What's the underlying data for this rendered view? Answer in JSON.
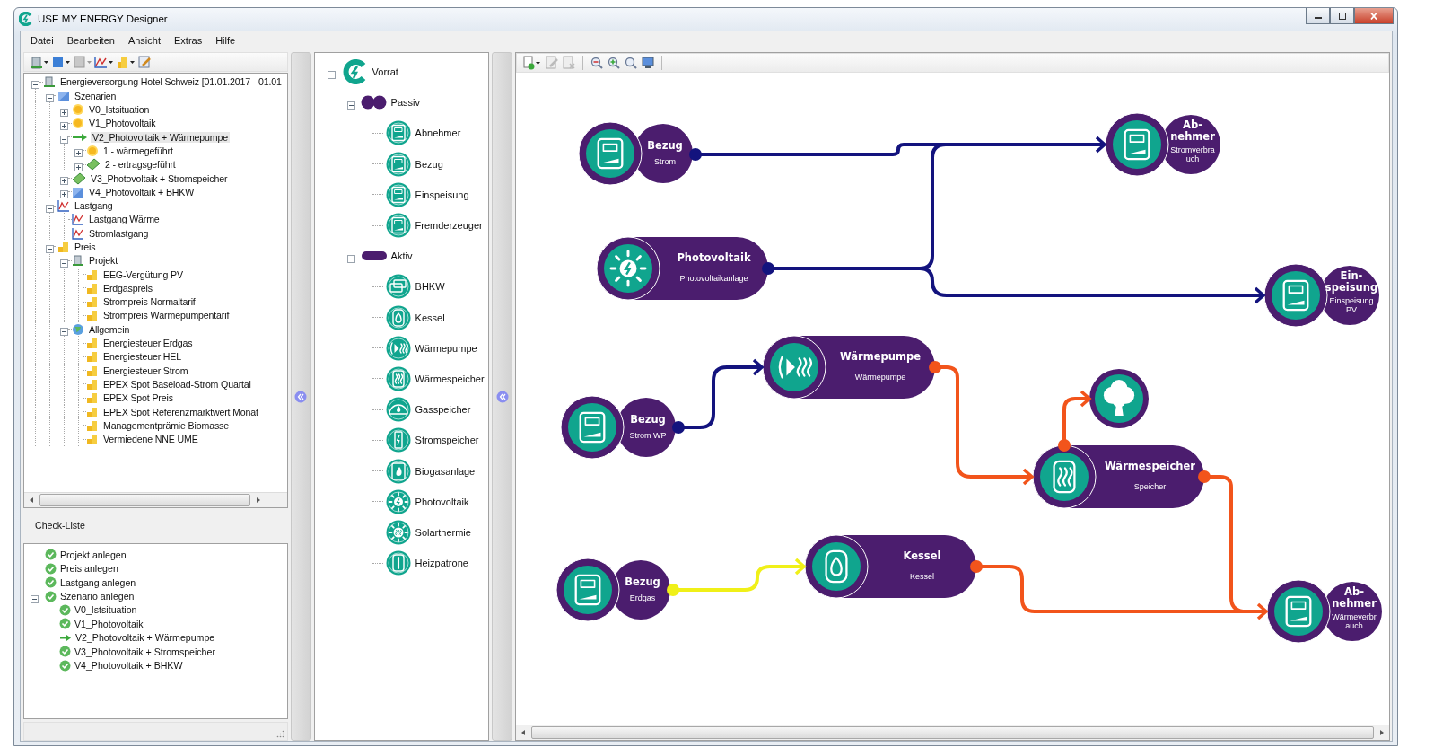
{
  "window": {
    "title": "USE MY ENERGY Designer"
  },
  "menu": [
    "Datei",
    "Bearbeiten",
    "Ansicht",
    "Extras",
    "Hilfe"
  ],
  "project_tree": [
    {
      "label": "Energieversorgung Hotel Schweiz [01.01.2017 - 01.01",
      "kind": "project",
      "expanded": true,
      "selected": false,
      "children": [
        {
          "label": "Szenarien",
          "kind": "square",
          "expanded": true,
          "selected": false,
          "children": [
            {
              "label": "V0_Istsituation",
              "kind": "sun",
              "expanded": false,
              "selected": false
            },
            {
              "label": "V1_Photovoltaik",
              "kind": "sun",
              "expanded": false,
              "selected": false
            },
            {
              "label": "V2_Photovoltaik + Wärmepumpe",
              "kind": "arrow",
              "expanded": true,
              "selected": true,
              "children": [
                {
                  "label": "1 - wärmegeführt",
                  "kind": "sun",
                  "expanded": false,
                  "selected": false
                },
                {
                  "label": "2 - ertragsgeführt",
                  "kind": "money",
                  "expanded": false,
                  "selected": false
                }
              ]
            },
            {
              "label": "V3_Photovoltaik + Stromspeicher",
              "kind": "money",
              "expanded": false,
              "selected": false
            },
            {
              "label": "V4_Photovoltaik + BHKW",
              "kind": "square",
              "expanded": false,
              "selected": false
            }
          ]
        },
        {
          "label": "Lastgang",
          "kind": "chart",
          "expanded": true,
          "selected": false,
          "children": [
            {
              "label": "Lastgang Wärme",
              "kind": "chart",
              "selected": false
            },
            {
              "label": "Stromlastgang",
              "kind": "chart",
              "selected": false
            }
          ]
        },
        {
          "label": "Preis",
          "kind": "coins",
          "expanded": true,
          "selected": false,
          "children": [
            {
              "label": "Projekt",
              "kind": "project",
              "expanded": true,
              "selected": false,
              "children": [
                {
                  "label": "EEG-Vergütung PV",
                  "kind": "coins",
                  "selected": false
                },
                {
                  "label": "Erdgaspreis",
                  "kind": "coins",
                  "selected": false
                },
                {
                  "label": "Strompreis Normaltarif",
                  "kind": "coins",
                  "selected": false
                },
                {
                  "label": "Strompreis Wärmepumpentarif",
                  "kind": "coins",
                  "selected": false
                }
              ]
            },
            {
              "label": "Allgemein",
              "kind": "globe",
              "expanded": true,
              "selected": false,
              "children": [
                {
                  "label": "Energiesteuer Erdgas",
                  "kind": "coins",
                  "selected": false
                },
                {
                  "label": "Energiesteuer HEL",
                  "kind": "coins",
                  "selected": false
                },
                {
                  "label": "Energiesteuer Strom",
                  "kind": "coins",
                  "selected": false
                },
                {
                  "label": "EPEX Spot Baseload-Strom Quartal",
                  "kind": "coins",
                  "selected": false
                },
                {
                  "label": "EPEX Spot Preis",
                  "kind": "coins",
                  "selected": false
                },
                {
                  "label": "EPEX Spot Referenzmarktwert Monat",
                  "kind": "coins",
                  "selected": false
                },
                {
                  "label": "Managementprämie Biomasse",
                  "kind": "coins",
                  "selected": false
                },
                {
                  "label": "Vermiedene NNE UME",
                  "kind": "coins",
                  "selected": false
                }
              ]
            }
          ]
        }
      ]
    }
  ],
  "checklist": {
    "title": "Check-Liste",
    "items": [
      {
        "label": "Projekt anlegen",
        "done": true
      },
      {
        "label": "Preis anlegen",
        "done": true
      },
      {
        "label": "Lastgang anlegen",
        "done": true
      },
      {
        "label": "Szenario anlegen",
        "done": true,
        "expanded": true,
        "children": [
          {
            "label": "V0_Istsituation",
            "done": true
          },
          {
            "label": "V1_Photovoltaik",
            "done": true
          },
          {
            "label": "V2_Photovoltaik + Wärmepumpe",
            "done": false
          },
          {
            "label": "V3_Photovoltaik + Stromspeicher",
            "done": true
          },
          {
            "label": "V4_Photovoltaik + BHKW",
            "done": true
          }
        ]
      }
    ]
  },
  "palette": {
    "label": "Vorrat",
    "expanded": true,
    "groups": [
      {
        "label": "Passiv",
        "kind": "passive",
        "expanded": true,
        "items": [
          {
            "label": "Abnehmer",
            "kind": "meter"
          },
          {
            "label": "Bezug",
            "kind": "meter"
          },
          {
            "label": "Einspeisung",
            "kind": "meter"
          },
          {
            "label": "Fremderzeuger",
            "kind": "meter"
          }
        ]
      },
      {
        "label": "Aktiv",
        "kind": "active",
        "expanded": true,
        "items": [
          {
            "label": "BHKW",
            "kind": "engine"
          },
          {
            "label": "Kessel",
            "kind": "flame"
          },
          {
            "label": "Wärmepumpe",
            "kind": "pump"
          },
          {
            "label": "Wärmespeicher",
            "kind": "heat"
          },
          {
            "label": "Gasspeicher",
            "kind": "gas"
          },
          {
            "label": "Stromspeicher",
            "kind": "battery"
          },
          {
            "label": "Biogasanlage",
            "kind": "leaf"
          },
          {
            "label": "Photovoltaik",
            "kind": "sun"
          },
          {
            "label": "Solarthermie",
            "kind": "solar-heat"
          },
          {
            "label": "Heizpatrone",
            "kind": "heater"
          }
        ]
      }
    ]
  },
  "diagram": {
    "nodes": [
      {
        "kind": "round",
        "title": [
          "Bezug"
        ],
        "subtitle": [
          "Strom"
        ]
      },
      {
        "kind": "round",
        "title": [
          "Ab-",
          "nehmer"
        ],
        "subtitle": [
          "Stromverbra",
          "uch"
        ]
      },
      {
        "kind": "pill",
        "title": [
          "Photovoltaik"
        ],
        "subtitle": [
          "Photovoltaikanlage"
        ]
      },
      {
        "kind": "round",
        "title": [
          "Ein-",
          "speisung"
        ],
        "subtitle": [
          "Einspeisung",
          "PV"
        ]
      },
      {
        "kind": "pill",
        "title": [
          "Wärmepumpe"
        ],
        "subtitle": [
          "Wärmepumpe"
        ]
      },
      {
        "kind": "bare"
      },
      {
        "kind": "round",
        "title": [
          "Bezug"
        ],
        "subtitle": [
          "Strom WP"
        ]
      },
      {
        "kind": "pill",
        "title": [
          "Wärmespeicher"
        ],
        "subtitle": [
          "Speicher"
        ]
      },
      {
        "kind": "round",
        "title": [
          "Bezug"
        ],
        "subtitle": [
          "Erdgas"
        ]
      },
      {
        "kind": "pill",
        "title": [
          "Kessel"
        ],
        "subtitle": [
          "Kessel"
        ]
      },
      {
        "kind": "round",
        "title": [
          "Ab-",
          "nehmer"
        ],
        "subtitle": [
          "Wärmeverbr",
          "auch"
        ]
      }
    ],
    "connections": [
      {
        "color": "#13137e"
      },
      {
        "color": "#13137e"
      },
      {
        "color": "#13137e"
      },
      {
        "color": "#13137e"
      },
      {
        "color": "#f2541b"
      },
      {
        "color": "#f2541b"
      },
      {
        "color": "#f2541b"
      },
      {
        "color": "#f2541b"
      },
      {
        "color": "#f0f018"
      }
    ]
  }
}
